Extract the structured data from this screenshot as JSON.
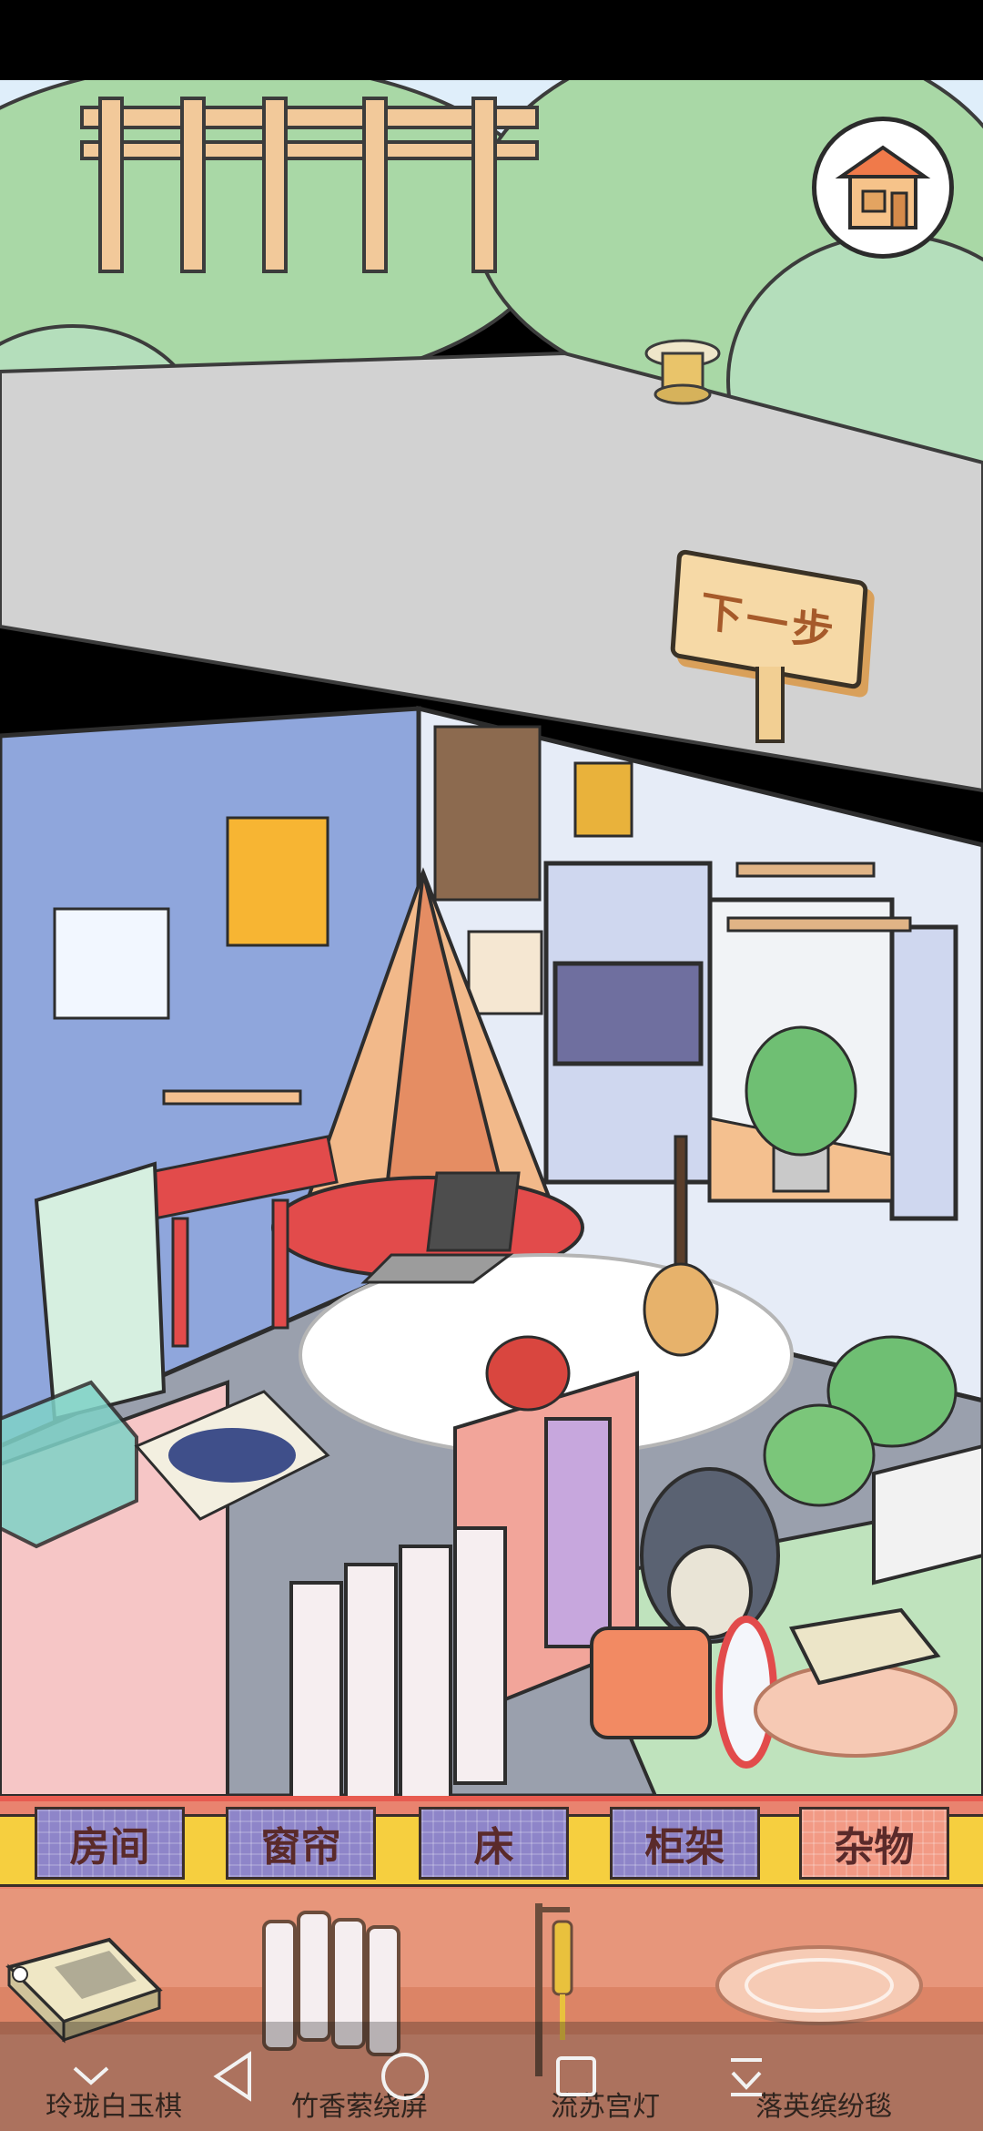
{
  "scene": {
    "next_button_label": "下一步",
    "home_icon": "house-icon"
  },
  "categories": [
    {
      "label": "房间",
      "active": false
    },
    {
      "label": "窗帘",
      "active": false
    },
    {
      "label": "床",
      "active": false
    },
    {
      "label": "柜架",
      "active": false
    },
    {
      "label": "杂物",
      "active": true
    }
  ],
  "items": [
    {
      "label": "玲珑白玉棋",
      "icon": "go-board-icon"
    },
    {
      "label": "竹香萦绕屏",
      "icon": "folding-screen-icon"
    },
    {
      "label": "流苏宫灯",
      "icon": "tassel-lantern-icon"
    },
    {
      "label": "落英缤纷毯",
      "icon": "round-rug-icon"
    }
  ],
  "nav": {
    "icons": [
      "collapse-icon",
      "back-icon",
      "home-circle-icon",
      "recents-icon",
      "download-icon"
    ]
  },
  "colors": {
    "grass": "#bfe3bd",
    "path": "#cfcfcf",
    "wall_blue": "#8fa6dc",
    "floor": "#9aa0ad",
    "tab": "#8e85c9",
    "tab_active": "#f29a85",
    "tray": "#e7967b"
  }
}
